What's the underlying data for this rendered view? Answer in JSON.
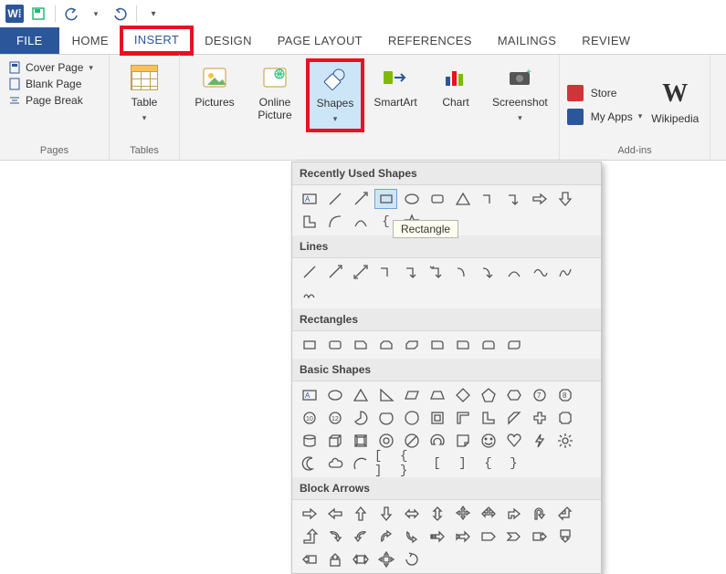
{
  "qat": {
    "word_glyph": "W⁞"
  },
  "tabs": {
    "file": "FILE",
    "home": "HOME",
    "insert": "INSERT",
    "design": "DESIGN",
    "pagelayout": "PAGE LAYOUT",
    "references": "REFERENCES",
    "mailings": "MAILINGS",
    "review": "REVIEW"
  },
  "ribbon": {
    "pages": {
      "label": "Pages",
      "cover": "Cover Page",
      "blank": "Blank Page",
      "break": "Page Break"
    },
    "tables": {
      "label": "Tables",
      "table": "Table"
    },
    "illustrations": {
      "pictures": "Pictures",
      "online": "Online\nPicture",
      "shapes": "Shapes",
      "smartart": "SmartArt",
      "chart": "Chart",
      "screenshot": "Screenshot"
    },
    "addins": {
      "label": "Add-ins",
      "store": "Store",
      "myapps": "My Apps",
      "wikipedia": "Wikipedia"
    }
  },
  "gallery": {
    "recently": "Recently Used Shapes",
    "lines": "Lines",
    "rectangles": "Rectangles",
    "basic": "Basic Shapes",
    "block": "Block Arrows"
  },
  "tooltip": {
    "rect": "Rectangle"
  }
}
